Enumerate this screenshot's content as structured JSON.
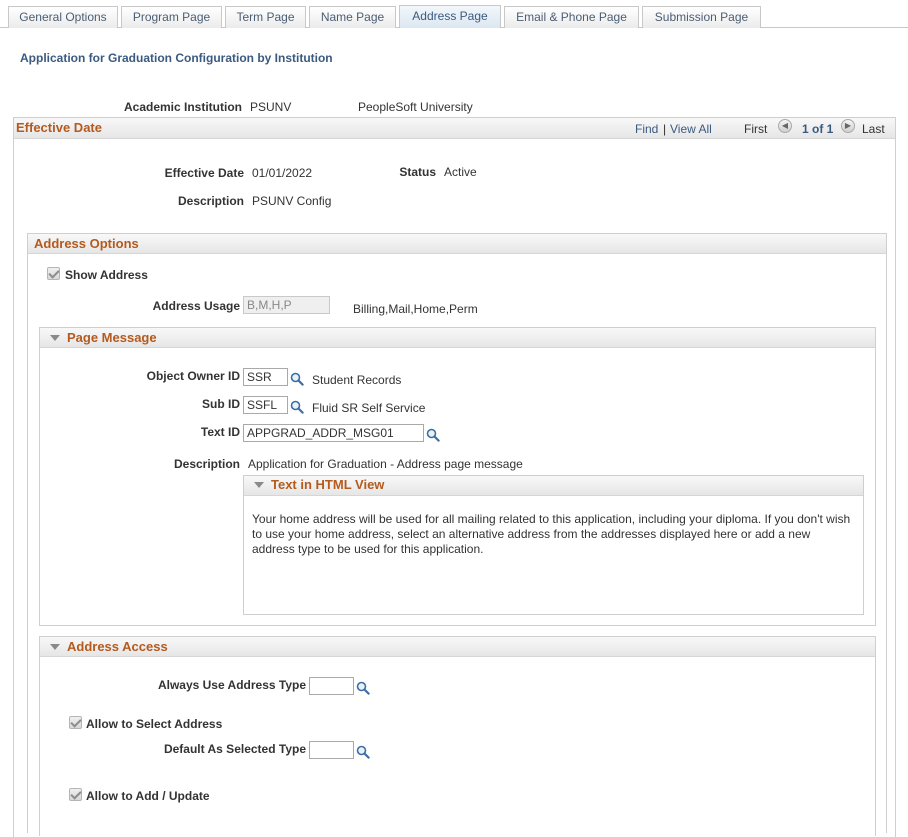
{
  "tabs": [
    {
      "label": "General Options"
    },
    {
      "label": "Program Page"
    },
    {
      "label": "Term Page"
    },
    {
      "label": "Name Page"
    },
    {
      "label": "Address Page"
    },
    {
      "label": "Email & Phone Page"
    },
    {
      "label": "Submission Page"
    }
  ],
  "active_tab": "Address Page",
  "page_title": "Application for Graduation Configuration by Institution",
  "institution": {
    "label": "Academic Institution",
    "code": "PSUNV",
    "name": "PeopleSoft University"
  },
  "effective_date_section": {
    "title": "Effective Date",
    "find": "Find",
    "separator": "|",
    "view_all": "View All",
    "first": "First",
    "counter": "1 of 1",
    "last": "Last",
    "effective_date_label": "Effective Date",
    "effective_date_value": "01/01/2022",
    "status_label": "Status",
    "status_value": "Active",
    "description_label": "Description",
    "description_value": "PSUNV Config"
  },
  "address_options": {
    "title": "Address Options",
    "show_address_label": "Show Address",
    "show_address_checked": true,
    "address_usage_label": "Address Usage",
    "address_usage_value": "B,M,H,P",
    "address_usage_desc": "Billing,Mail,Home,Perm"
  },
  "page_message": {
    "title": "Page Message",
    "object_owner_label": "Object Owner ID",
    "object_owner_value": "SSR",
    "object_owner_desc": "Student Records",
    "sub_id_label": "Sub ID",
    "sub_id_value": "SSFL",
    "sub_id_desc": "Fluid SR Self Service",
    "text_id_label": "Text ID",
    "text_id_value": "APPGRAD_ADDR_MSG01",
    "description_label": "Description",
    "description_value": "Application for Graduation - Address page message",
    "html_view": {
      "title": "Text in HTML View",
      "text": "Your home address will be used for all mailing related to this application, including your diploma. If you don't wish to use your home address, select an alternative address from the addresses displayed here or add a new address type to be used for this application."
    }
  },
  "address_access": {
    "title": "Address Access",
    "always_use_label": "Always Use Address Type",
    "always_use_value": "",
    "allow_select_label": "Allow to Select Address",
    "allow_select_checked": true,
    "default_selected_label": "Default As Selected Type",
    "default_selected_value": "",
    "allow_add_label": "Allow to Add / Update",
    "allow_add_checked": true
  },
  "colors": {
    "section_title": "#b45a1e",
    "link": "#3a5a80",
    "border": "#cfcfcf"
  }
}
